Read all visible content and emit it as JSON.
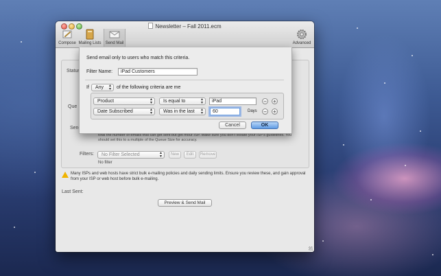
{
  "window": {
    "title": "Newsletter – Fall 2011.ecm",
    "toolbar": {
      "compose": "Compose",
      "mailing_lists": "Mailing Lists",
      "send_mail": "Send Mail",
      "advanced": "Advanced"
    }
  },
  "background_panel": {
    "status_label": "Status",
    "queue_label": "Que",
    "send_label": "Send",
    "hint_line1": "total the number of emails that can get sent but get mour ISP. Make sure you don't violate your ISP's guidelines. You",
    "hint_line2": "should set this to a multiple of the Queue Size for accuracy.",
    "filters_label": "Filters:",
    "filter_select": "No Filter Selected",
    "new_button": "New",
    "edit_button": "Edit",
    "remove_button": "Remove",
    "no_filter_text": "No filter"
  },
  "warning": {
    "line1": "Many ISPs and web hosts have strict bulk e-mailing policies and daily sending limits. Ensure you review these, and gain approval",
    "line2": "from your ISP or web host before bulk e-mailing."
  },
  "last_sent_label": "Last Sent:",
  "preview_button": "Preview & Send Mail",
  "sheet": {
    "heading": "Send email only to users who match this criteria.",
    "filter_name_label": "Filter Name:",
    "filter_name_value": "iPad Customers",
    "if_label": "If",
    "match_select": "Any",
    "criteria_suffix": "of the following criteria are me",
    "rows": [
      {
        "field": "Product",
        "operator": "Is equal to",
        "value": "iPad",
        "unit": ""
      },
      {
        "field": "Date Subscribed",
        "operator": "Was in the last",
        "value": "60",
        "unit": "Days"
      }
    ],
    "remove_symbol": "−",
    "add_symbol": "+",
    "cancel_button": "Cancel",
    "ok_button": "OK"
  }
}
